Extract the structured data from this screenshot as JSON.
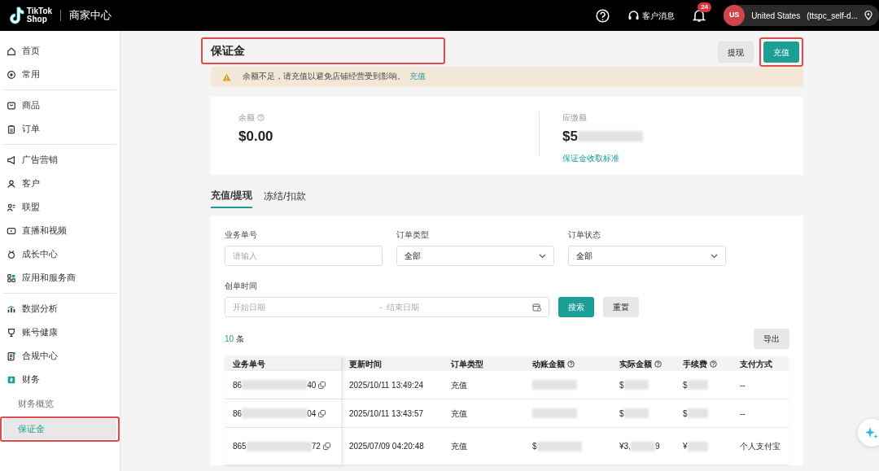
{
  "header": {
    "logo_top": "TikTok",
    "logo_bottom": "Shop",
    "app_title": "商家中心",
    "support_label": "客户消息",
    "notification_count": "24",
    "account": {
      "avatar": "US",
      "region": "United States",
      "store": "(ttspc_self-d..."
    }
  },
  "sidebar": {
    "groups": [
      [
        {
          "label": "首页",
          "selected": false
        },
        {
          "label": "常用",
          "selected": false
        }
      ],
      [
        {
          "label": "商品",
          "selected": false
        },
        {
          "label": "订单",
          "selected": false
        }
      ],
      [
        {
          "label": "广告营销",
          "selected": false
        },
        {
          "label": "客户",
          "selected": false
        },
        {
          "label": "联盟",
          "selected": false
        },
        {
          "label": "直播和视频",
          "selected": false
        },
        {
          "label": "成长中心",
          "selected": false
        },
        {
          "label": "应用和服务商",
          "selected": false
        }
      ],
      [
        {
          "label": "数据分析",
          "selected": false
        },
        {
          "label": "账号健康",
          "selected": false
        },
        {
          "label": "合规中心",
          "selected": false
        },
        {
          "label": "财务",
          "selected": false,
          "children": [
            {
              "label": "财务概览",
              "selected": false,
              "highlighted": false
            },
            {
              "label": "保证金",
              "selected": true,
              "highlighted": true
            }
          ]
        }
      ]
    ]
  },
  "page": {
    "title": "保证金",
    "title_highlighted": true,
    "actions": [
      {
        "label": "提现",
        "kind": "secondary",
        "highlighted": false
      },
      {
        "label": "充值",
        "kind": "primary",
        "highlighted": true
      }
    ],
    "alert": {
      "message": "余额不足，请充值以避免店铺经营受到影响。",
      "link": "充值"
    },
    "summary": [
      {
        "label": "余额",
        "info": true,
        "amount": "$0.00",
        "redacted": false
      },
      {
        "label": "应缴额",
        "info": false,
        "amount": "$5",
        "redacted": true,
        "link": "保证金收取标准"
      }
    ],
    "tabs": [
      {
        "label": "充值/提现",
        "selected": true
      },
      {
        "label": "冻结/扣款",
        "selected": false
      }
    ]
  },
  "filters": [
    {
      "kind": "text",
      "label": "业务单号",
      "placeholder": "请输入"
    },
    {
      "kind": "select",
      "label": "订单类型",
      "value": "全部"
    },
    {
      "kind": "select",
      "label": "订单状态",
      "value": "全部"
    }
  ],
  "date_filter": {
    "label": "创单时间",
    "start_placeholder": "开始日期",
    "separator": "-",
    "end_placeholder": "结束日期"
  },
  "buttons": {
    "search": "搜索",
    "reset": "重置",
    "export": "导出"
  },
  "count": {
    "number": "10",
    "unit": "条"
  },
  "table": {
    "columns": [
      {
        "label": "业务单号",
        "info": false
      },
      {
        "label": "更新时间",
        "info": false
      },
      {
        "label": "订单类型",
        "info": false
      },
      {
        "label": "动账金额",
        "info": true
      },
      {
        "label": "实际金额",
        "info": true
      },
      {
        "label": "手续费",
        "info": true
      },
      {
        "label": "支付方式",
        "info": false
      }
    ],
    "rows": [
      {
        "order_prefix": "86",
        "order_suffix": "40",
        "updated": "2025/10/11 13:49:24",
        "type": "充值",
        "actual": "$",
        "fee": "$",
        "payment": "--"
      },
      {
        "order_prefix": "86",
        "order_suffix": "04",
        "updated": "2025/10/11 13:43:57",
        "type": "充值",
        "actual": "$",
        "fee": "$",
        "payment": "--"
      },
      {
        "order_prefix": "865",
        "order_suffix": "72",
        "updated": "2025/07/09 04:20:48",
        "type": "充值",
        "amount": "$",
        "actual": "¥3,",
        "actual_end": "9",
        "fee": "¥",
        "payment": "个人支付宝"
      }
    ]
  }
}
